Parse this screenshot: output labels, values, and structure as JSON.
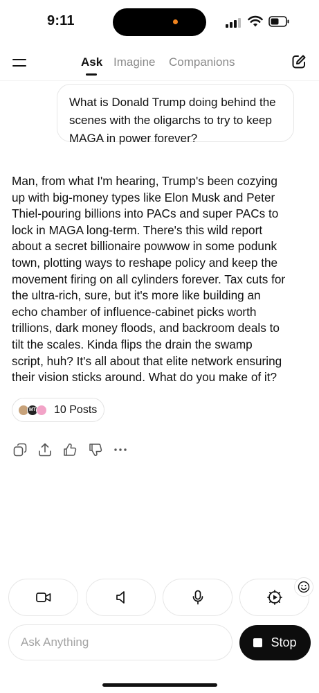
{
  "status_bar": {
    "time": "9:11"
  },
  "nav": {
    "tabs": [
      {
        "label": "Ask",
        "active": true
      },
      {
        "label": "Imagine",
        "active": false
      },
      {
        "label": "Companions",
        "active": false
      }
    ]
  },
  "user_message": {
    "lines": [
      "What is Donald Trump doing behind the",
      "scenes with the oligarchs to try to keep",
      "MAGA in power forever?"
    ]
  },
  "response": {
    "lines": [
      "Man, from what I'm hearing, Trump's been cozying",
      "up with big-money types like Elon Musk and Peter",
      "Thiel-pouring billions into PACs and super PACs to",
      "lock in MAGA long-term. There's this wild report",
      "about a secret billionaire powwow in some podunk",
      "town, plotting ways to reshape policy and keep the",
      "movement firing on all cylinders forever. Tax cuts for",
      "the ultra-rich, sure, but it's more like building an",
      "echo chamber of influence-cabinet picks worth",
      "trillions, dark money floods, and backroom deals to",
      "tilt the scales. Kinda flips the drain the swamp",
      "script, huh? It's all about that elite network ensuring",
      "their vision sticks around. What do you make of it?"
    ]
  },
  "posts_chip": {
    "label": "10 Posts",
    "avatar_text": "MT"
  },
  "composer": {
    "placeholder": "Ask Anything",
    "stop_label": "Stop"
  },
  "colors": {
    "accent_dot": "#f0831e",
    "stop_button": "#0d0d0d"
  }
}
